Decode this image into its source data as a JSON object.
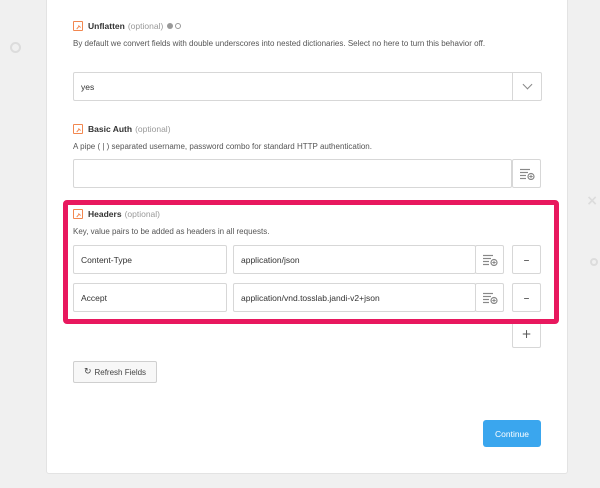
{
  "fields": {
    "unflatten": {
      "label": "Unflatten",
      "optional": "(optional)",
      "description": "By default we convert fields with double underscores into nested dictionaries. Select no here to turn this behavior off.",
      "value": "yes"
    },
    "basic_auth": {
      "label": "Basic Auth",
      "optional": "(optional)",
      "description": "A pipe ( | ) separated username, password combo for standard HTTP authentication.",
      "value": ""
    },
    "headers": {
      "label": "Headers",
      "optional": "(optional)",
      "description": "Key, value pairs to be added as headers in all requests.",
      "rows": [
        {
          "key": "Content-Type",
          "value": "application/json"
        },
        {
          "key": "Accept",
          "value": "application/vnd.tosslab.jandi-v2+json"
        }
      ],
      "remove_symbol": "–",
      "add_symbol": "+"
    }
  },
  "buttons": {
    "refresh": "Refresh Fields",
    "continue": "Continue"
  },
  "colors": {
    "highlight": "#e8185e",
    "primary": "#3aa6ee",
    "field_icon": "#f2874f"
  }
}
